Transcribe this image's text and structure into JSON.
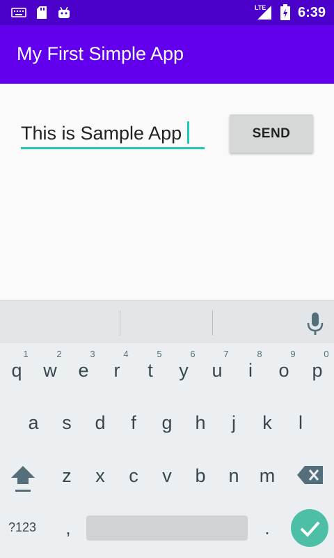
{
  "status_bar": {
    "time": "6:39",
    "network": "LTE",
    "icons": [
      "keyboard-icon",
      "sd-card-icon",
      "android-icon",
      "signal-icon",
      "battery-charging-icon"
    ]
  },
  "app_bar": {
    "title": "My First Simple App"
  },
  "form": {
    "text_value": "This is Sample App",
    "send_label": "SEND"
  },
  "keyboard": {
    "row1": [
      {
        "key": "q",
        "hint": "1"
      },
      {
        "key": "w",
        "hint": "2"
      },
      {
        "key": "e",
        "hint": "3"
      },
      {
        "key": "r",
        "hint": "4"
      },
      {
        "key": "t",
        "hint": "5"
      },
      {
        "key": "y",
        "hint": "6"
      },
      {
        "key": "u",
        "hint": "7"
      },
      {
        "key": "i",
        "hint": "8"
      },
      {
        "key": "o",
        "hint": "9"
      },
      {
        "key": "p",
        "hint": "0"
      }
    ],
    "row2": [
      "a",
      "s",
      "d",
      "f",
      "g",
      "h",
      "j",
      "k",
      "l"
    ],
    "row3": [
      "z",
      "x",
      "c",
      "v",
      "b",
      "n",
      "m"
    ],
    "symbols_label": "?123",
    "comma": ",",
    "period": ".",
    "accent_color": "#4cbfa6"
  },
  "colors": {
    "status_bar": "#4a00c8",
    "app_bar": "#6200ee",
    "field_accent": "#1ec8b6"
  }
}
